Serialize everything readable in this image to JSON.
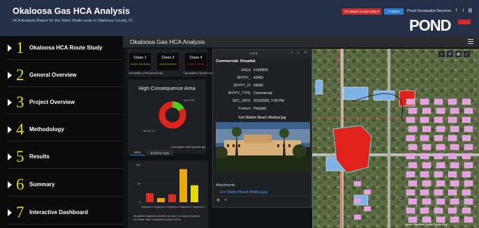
{
  "header": {
    "title": "Okaloosa Gas HCA Analysis",
    "subtitle": "HCA Analysis Report for the Silver Shells route in Okaloosa County, FL",
    "fix_issues_label": "Fix issues in your story ▾",
    "edit_label": "✎ Edit ▾",
    "brand_name": "Pond Geospatial Services",
    "logo_text": "POND",
    "social_icons": [
      "facebook-icon",
      "twitter-icon",
      "link-icon"
    ]
  },
  "sidebar": {
    "items": [
      {
        "num": "1",
        "label": "Okaloosa HCA Route Study"
      },
      {
        "num": "2",
        "label": "General Overview"
      },
      {
        "num": "3",
        "label": "Project Overview"
      },
      {
        "num": "4",
        "label": "Methodology"
      },
      {
        "num": "5",
        "label": "Results"
      },
      {
        "num": "6",
        "label": "Summary"
      },
      {
        "num": "7",
        "label": "Interactive Dashboard"
      }
    ]
  },
  "dashboard": {
    "title": "Okaloosa Gas HCA Analysis",
    "class_cards": [
      {
        "title": "Class 1",
        "sub": "CLASS 1 NO VALUE",
        "color": "#e7d800"
      },
      {
        "title": "Class 3",
        "sub": "CLASS 3 STATUS",
        "color": "#e7d800"
      },
      {
        "title": "Class 4",
        "sub": "CLASS 4 STATUS",
        "color": "#ff3a2a"
      }
    ],
    "last_update_1": "Last update: a few seconds ago",
    "last_update_2": "Last update: a few seconds ago",
    "hca_title": "High Consequence Area",
    "donut_labels": {
      "yes": "Yes: 5.3%",
      "no": "No: 94.7%"
    },
    "hca_last_update": "Last update: a few seconds ago",
    "tabs": [
      "HCA",
      "Building Type"
    ],
    "bar_y_ticks": [
      "10k",
      "5k",
      "0"
    ],
    "bar_x_label": "Segment 1 Segment 2 Segment 3 Segment 4 Segment 5",
    "bar_note": "All pipeline segments identified as class 3 or class 4 locations are known High Consequence Areas (HCA)."
  },
  "chart_data": {
    "type": "bar",
    "categories": [
      "Segment 1",
      "Segment 2",
      "Segment 3",
      "Segment 4",
      "Segment 5"
    ],
    "values": [
      2400,
      1100,
      2100,
      8800,
      4500
    ],
    "colors": [
      "#e02a1e",
      "#f0a800",
      "#e02a1e",
      "#f0a800",
      "#e7d800"
    ],
    "ylim": [
      0,
      10000
    ]
  },
  "donut_data": {
    "yes_pct": 5.3,
    "no_pct": 94.7,
    "colors": {
      "yes": "#4ad11f",
      "no": "#e0221c"
    }
  },
  "popup": {
    "page": "1 of 4",
    "heading": "Commercial: Hospital",
    "attributes": [
      {
        "key": "AREA",
        "value": "0.000000"
      },
      {
        "key": "BFPPY_",
        "value": "42459"
      },
      {
        "key": "BFPPY_ID",
        "value": "43660"
      },
      {
        "key": "BFPPY_TYPE",
        "value": "Commercial"
      },
      {
        "key": "SRC_DATE",
        "value": "5/19/2006, 7:00 PM"
      },
      {
        "key": "Feature",
        "value": "Hospital"
      }
    ],
    "photo_title": "Fort Walton Beach Medical.jpg",
    "attachments_label": "Attachments",
    "attachment_link": "Fort Walton Beach Medical.jpg"
  },
  "map": {
    "credit": "Maxar | Okaloosa County, Florida | Esri"
  }
}
